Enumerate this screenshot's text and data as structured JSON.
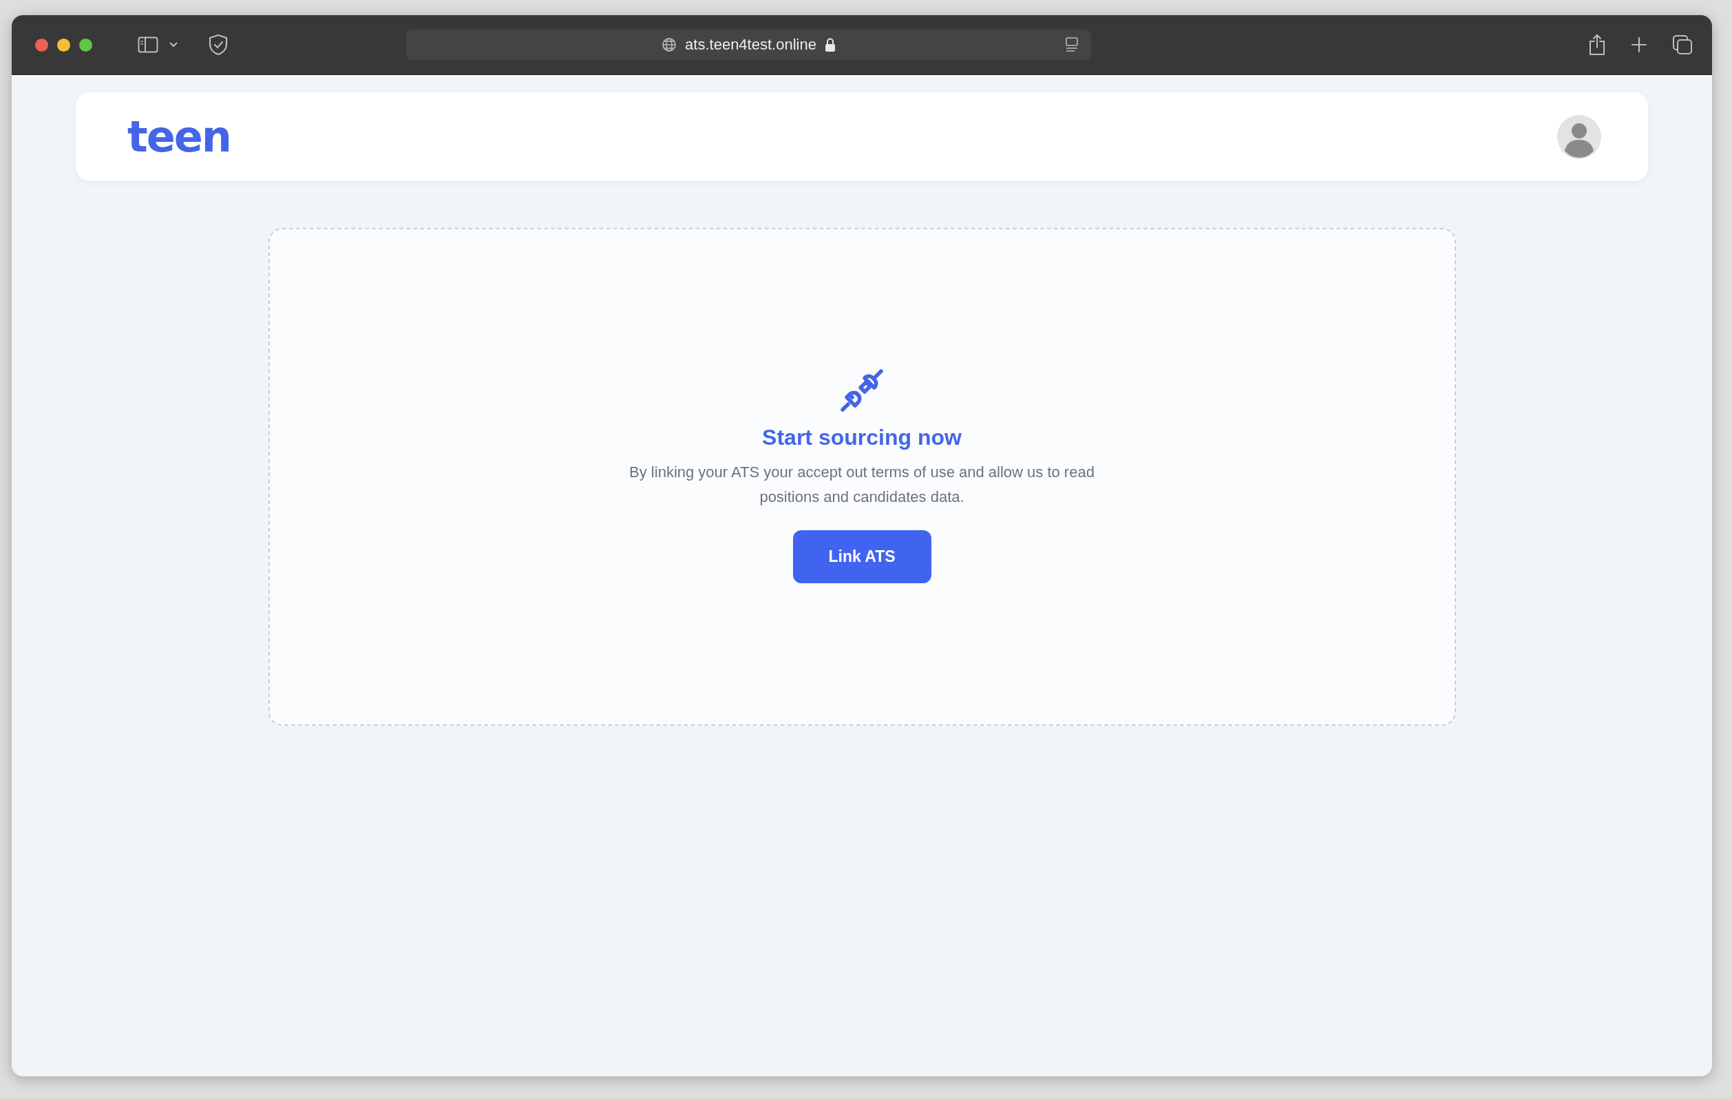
{
  "browser": {
    "url": "ats.teen4test.online"
  },
  "header": {
    "logo": "teen"
  },
  "empty_state": {
    "title": "Start sourcing now",
    "description": "By linking your ATS your accept out terms of use and allow us to read positions and candidates data.",
    "button": "Link ATS"
  }
}
